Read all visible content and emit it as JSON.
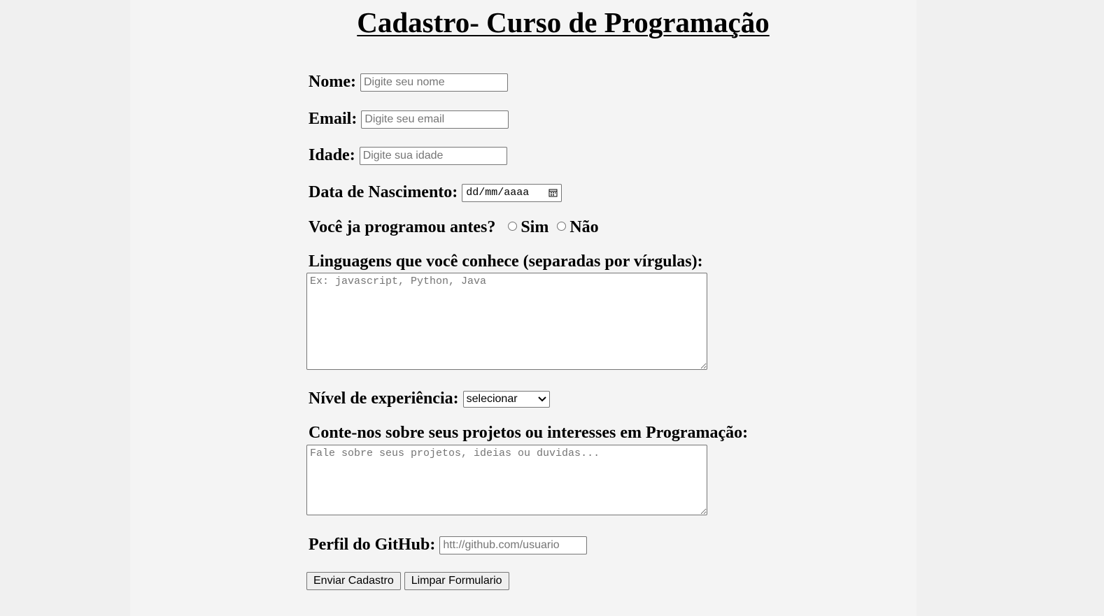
{
  "form": {
    "title": "Cadastro- Curso de Programação",
    "name_label": "Nome:",
    "name_placeholder": "Digite seu nome",
    "email_label": "Email:",
    "email_placeholder": "Digite seu email",
    "age_label": "Idade:",
    "age_placeholder": "Digite sua idade",
    "birth_label": "Data de Nascimento:",
    "birth_value": "dd/mm/aaaa",
    "programmed_label": "Você ja programou antes?",
    "programmed_options": [
      "Sim",
      "Não"
    ],
    "languages_label": "Linguagens que você conhece (separadas por vírgulas):",
    "languages_placeholder": "Ex: javascript, Python, Java",
    "level_label": "Nível de experiência:",
    "level_selected": "selecionar",
    "projects_label": "Conte-nos sobre seus projetos ou interesses em Programação:",
    "projects_placeholder": "Fale sobre seus projetos, ideias ou duvidas...",
    "github_label": "Perfil do GitHub:",
    "github_placeholder": "htt://github.com/usuario",
    "submit_label": "Enviar Cadastro",
    "reset_label": "Limpar Formulario"
  }
}
